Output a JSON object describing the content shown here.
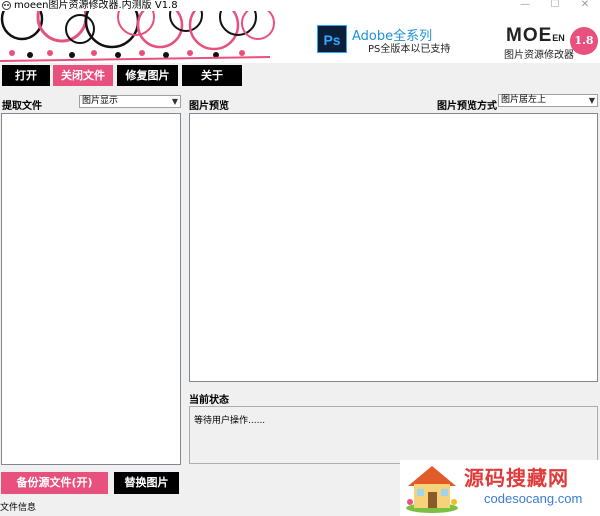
{
  "window": {
    "title": "moeen图片资源修改器.内测版 V1.8",
    "minimize": "—",
    "maximize": "☐",
    "close": "✕"
  },
  "banner": {
    "ps_icon": "Ps",
    "adobe_title": "Adobe全系列",
    "adobe_subtitle": "PS全版本以已支持",
    "logo_main": "MOE",
    "logo_suffix": "EN",
    "logo_subtitle": "图片资源修改器",
    "version": "1.8"
  },
  "toolbar": {
    "open_label": "打开",
    "close_file_label": "关闭文件",
    "repair_label": "修复图片",
    "about_label": "关于"
  },
  "left_panel": {
    "label": "提取文件",
    "select_value": "图片显示"
  },
  "preview": {
    "label": "图片预览",
    "mode_label": "图片预览方式",
    "mode_value": "图片居左上"
  },
  "status": {
    "label": "当前状态",
    "text": "等待用户操作......"
  },
  "bottom": {
    "backup_label": "备份源文件(开)",
    "replace_label": "替换图片",
    "file_info": "文件信息"
  },
  "watermark": {
    "title": "源码搜藏网",
    "url": "codesocang.com"
  },
  "colors": {
    "accent_pink": "#e8517e",
    "dark": "#000000"
  }
}
